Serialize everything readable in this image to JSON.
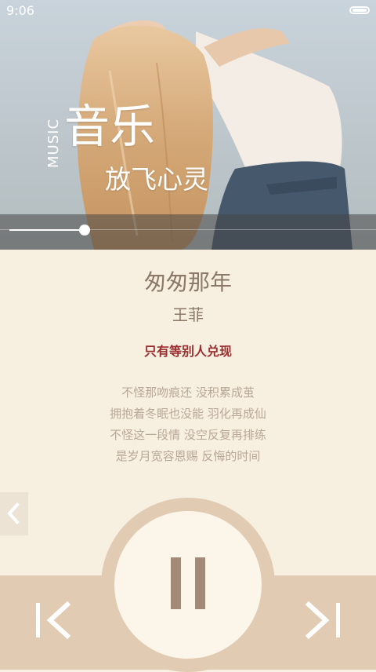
{
  "status_bar": {
    "time": "9:06"
  },
  "hero": {
    "vertical_label": "MUSIC",
    "title": "音乐",
    "subtitle": "放飞心灵",
    "image_description": "woman with long blond hair arching backwards against sky"
  },
  "playback": {
    "progress_fraction": 0.21
  },
  "song": {
    "title": "匆匆那年",
    "artist": "王菲",
    "current_lyric": "只有等别人兑现",
    "lyrics": [
      "不怪那吻痕还  没积累成茧",
      "拥抱着冬眠也没能  羽化再成仙",
      "不怪这一段情  没空反复再排练",
      "是岁月宽容恩赐  反悔的时间"
    ]
  },
  "controls": {
    "back_icon": "chevron-left-icon",
    "prev_icon": "skip-previous-icon",
    "play_icon": "pause-icon",
    "next_icon": "skip-next-icon"
  },
  "colors": {
    "background": "#f7efe0",
    "accent": "#9a2e2e",
    "control": "#e1cbb2",
    "button_face": "#fcf5ea",
    "icon": "#a38a78"
  }
}
